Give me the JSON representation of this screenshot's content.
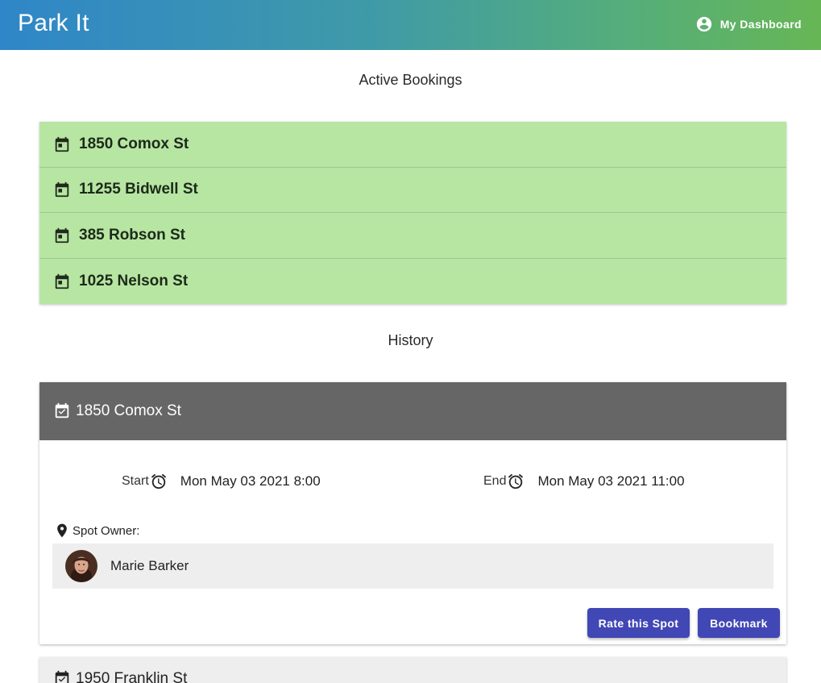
{
  "app": {
    "title": "Park It"
  },
  "header": {
    "dashboard_label": "My Dashboard",
    "dashboard_icon": "account-circle-icon"
  },
  "sections": {
    "active_title": "Active Bookings",
    "history_title": "History"
  },
  "colors": {
    "active_bg": "#b7e6a3",
    "history_header_bg": "#666666",
    "button_bg": "#4147b5"
  },
  "active_bookings": [
    {
      "address": "1850 Comox St",
      "icon": "calendar-icon"
    },
    {
      "address": "11255 Bidwell St",
      "icon": "calendar-icon"
    },
    {
      "address": "385 Robson St",
      "icon": "calendar-icon"
    },
    {
      "address": "1025 Nelson St",
      "icon": "calendar-icon"
    }
  ],
  "history": [
    {
      "address": "1850 Comox St",
      "icon": "calendar-check-icon",
      "expanded": true,
      "start_label": "Start",
      "start_value": "Mon May 03 2021 8:00",
      "end_label": "End",
      "end_value": "Mon May 03 2021 11:00",
      "owner_label": "Spot Owner:",
      "owner_name": "Marie Barker",
      "rate_label": "Rate this Spot",
      "bookmark_label": "Bookmark"
    },
    {
      "address": "1950 Franklin St",
      "icon": "calendar-check-icon",
      "expanded": false
    }
  ]
}
